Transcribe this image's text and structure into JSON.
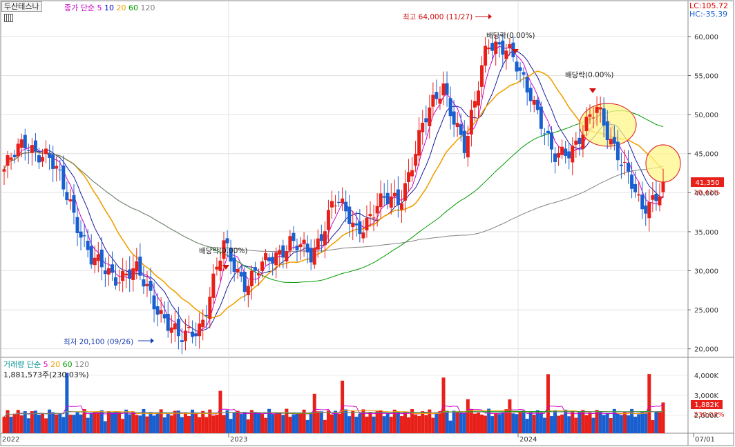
{
  "header": {
    "stock_name": "두산테스나",
    "ma_label": "종가 단순",
    "ma_periods": [
      "5",
      "10",
      "20",
      "60",
      "120"
    ],
    "ma_colors": [
      "#cc00cc",
      "#0000cc",
      "#f0a000",
      "#009900",
      "#808080"
    ],
    "lc_label": "LC:105.72",
    "hc_label": "HC:-35.39"
  },
  "volume_header": {
    "label": "거래량 단순",
    "ma_periods": [
      "5",
      "20",
      "60",
      "120"
    ],
    "current": "1,881,573주(230.03%)"
  },
  "price_axis": {
    "ticks": [
      "60,000",
      "55,000",
      "50,000",
      "45,000",
      "40,000",
      "35,000",
      "30,000",
      "25,000",
      "20,000"
    ],
    "current_price": "41,350",
    "current_change": "10.41%"
  },
  "volume_axis": {
    "ticks": [
      "4,000K",
      "3,000K",
      "2,000K"
    ],
    "current_volume": "1,882K",
    "current_ratio": "230.03%"
  },
  "time_axis": {
    "labels": [
      "2022",
      "2023",
      "2024",
      "07/01"
    ]
  },
  "annotations": {
    "high": "최고 64,000 (11/27)",
    "low": "최저 20,100 (09/26)",
    "dividend1": "배당락(0.00%)",
    "dividend2": "배당락(0.00%)",
    "dividend3": "배당락(0.00%)"
  },
  "colors": {
    "up": "#e8201a",
    "down": "#1a5fd0",
    "ma5": "#cc00cc",
    "ma10": "#1a1aa0",
    "ma20": "#f0a000",
    "ma60": "#009900",
    "ma120": "#808080",
    "highlight": "#fff58a"
  },
  "chart_data": {
    "type": "candlestick",
    "period": "weekly",
    "ylim": [
      19000,
      64500
    ],
    "price_close_points": [
      {
        "date": "2022-01",
        "value": 43000
      },
      {
        "date": "2022-02",
        "value": 46500
      },
      {
        "date": "2022-03",
        "value": 44500
      },
      {
        "date": "2022-04",
        "value": 39000
      },
      {
        "date": "2022-05",
        "value": 31000
      },
      {
        "date": "2022-06",
        "value": 29500
      },
      {
        "date": "2022-07",
        "value": 29800
      },
      {
        "date": "2022-08",
        "value": 25500
      },
      {
        "date": "2022-09",
        "value": 20800
      },
      {
        "date": "2022-10",
        "value": 23500
      },
      {
        "date": "2022-11",
        "value": 33000
      },
      {
        "date": "2022-12",
        "value": 28500
      },
      {
        "date": "2023-01",
        "value": 31000
      },
      {
        "date": "2023-02",
        "value": 34000
      },
      {
        "date": "2023-03",
        "value": 31500
      },
      {
        "date": "2023-04",
        "value": 39500
      },
      {
        "date": "2023-05",
        "value": 35000
      },
      {
        "date": "2023-06",
        "value": 38500
      },
      {
        "date": "2023-07",
        "value": 39000
      },
      {
        "date": "2023-08",
        "value": 48000
      },
      {
        "date": "2023-09",
        "value": 54000
      },
      {
        "date": "2023-10",
        "value": 45000
      },
      {
        "date": "2023-11",
        "value": 60000
      },
      {
        "date": "2023-12",
        "value": 57500
      },
      {
        "date": "2024-01",
        "value": 53000
      },
      {
        "date": "2024-02",
        "value": 44000
      },
      {
        "date": "2024-03",
        "value": 46500
      },
      {
        "date": "2024-04",
        "value": 50500
      },
      {
        "date": "2024-05",
        "value": 45000
      },
      {
        "date": "2024-06",
        "value": 37500
      },
      {
        "date": "2024-07",
        "value": 41350
      }
    ],
    "current_close": 41350,
    "current_volume": 1881573,
    "high": {
      "value": 64000,
      "date": "11/27"
    },
    "low": {
      "value": 20100,
      "date": "09/26"
    }
  }
}
